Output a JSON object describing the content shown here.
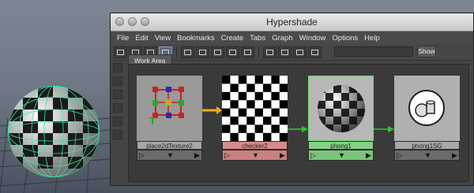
{
  "window": {
    "title": "Hypershade"
  },
  "menubar": {
    "items": [
      "File",
      "Edit",
      "View",
      "Bookmarks",
      "Create",
      "Tabs",
      "Graph",
      "Window",
      "Options",
      "Help"
    ]
  },
  "toolbar": {
    "show_label": "Show"
  },
  "tabs": [
    {
      "label": "Work Area"
    }
  ],
  "nodes": [
    {
      "name": "place2dTexture2",
      "selected": false
    },
    {
      "name": "checker2",
      "selected": false
    },
    {
      "name": "phong1",
      "selected": true
    },
    {
      "name": "phong1SG",
      "selected": false
    }
  ],
  "colors": {
    "connection_arrow_orange": "#f2a81f",
    "connection_arrow_green": "#35c435",
    "checker_label_bg": "#d88a8a",
    "phong_label_bg": "#86d086",
    "neutral_label_bg": "#a8a8a8"
  },
  "icons": [
    "close-icon",
    "minimize-icon",
    "maximize-icon",
    "arrow-left-icon",
    "arrow-down-icon",
    "arrow-right-icon"
  ]
}
